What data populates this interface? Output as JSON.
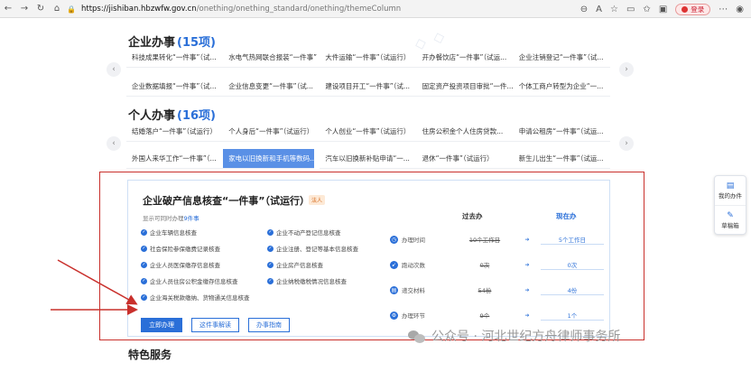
{
  "browser": {
    "url_host": "https://jishiban.hbzwfw.gov.cn",
    "url_path": "/onething/onething_standard/onething/themeColumn",
    "login_label": "登录"
  },
  "enterprise": {
    "title": "企业办事",
    "count": "(15项)",
    "items": [
      "科技成果转化“一件事”（试...",
      "水电气热网联合报装“一件事”",
      "大件运输“一件事”（试运行）",
      "开办餐饮店“一件事”（试运...",
      "企业注销登记“一件事”（试...",
      "企业数据填报“一件事”（试...",
      "企业信息变更“一件事”（试...",
      "建设项目开工“一件事”（试...",
      "固定资产投资项目审批“一件...",
      "个体工商户转型为企业“一..."
    ]
  },
  "personal": {
    "title": "个人办事",
    "count": "(16项)",
    "items": [
      "结婚落户“一件事”（试运行）",
      "个人身后“一件事”（试运行）",
      "个人创业“一件事”（试运行）",
      "住房公积金个人住房贷款...",
      "申请公租房“一件事”（试运...",
      "外国人来华工作“一件事”（...",
      "家电以旧换新和手机等数码...",
      "汽车以旧换新补贴申请“一...",
      "退休“一件事”（试运行）",
      "新生儿出生“一件事”（试运..."
    ]
  },
  "detail": {
    "title": "企业破产信息核查“一件事”（试运行）",
    "tag": "法人",
    "subtitle_prefix": "显示可同时办理",
    "subtitle_highlight": "9件事",
    "checks": [
      "企业车辆信息核查",
      "企业不动产登记信息核查",
      "社会保险参保缴费记录核查",
      "企业注册、登记等基本信息核查",
      "企业人员医保缴存信息核查",
      "企业房产信息核查",
      "企业人员住房公积金缴存信息核查",
      "企业纳税缴税情况信息核查",
      "企业海关税款缴纳、货物通关信息核查"
    ],
    "buttons": {
      "apply": "立即办理",
      "explain": "这件事解读",
      "guide": "办事指南"
    },
    "compare": {
      "before_label": "过去办",
      "now_label": "现在办",
      "rows": [
        {
          "icon": "clock-icon",
          "label": "办理时间",
          "before": "10个工作日",
          "now": "5个工作日"
        },
        {
          "icon": "running-icon",
          "label": "跑动次数",
          "before": "0次",
          "now": "0次"
        },
        {
          "icon": "folder-icon",
          "label": "递交材料",
          "before": "54份",
          "now": "4份"
        },
        {
          "icon": "steps-icon",
          "label": "办理环节",
          "before": "9个",
          "now": "1个"
        }
      ]
    }
  },
  "special": {
    "title": "特色服务"
  },
  "float_panel": {
    "my_tasks": "我的办件",
    "draft_box": "草稿箱"
  },
  "watermark": {
    "text": "公众号 · 河北世纪方舟律师事务所"
  },
  "colors": {
    "accent": "#2a6fd8",
    "frame": "#c9302c",
    "active_item": "#5a90e6"
  }
}
